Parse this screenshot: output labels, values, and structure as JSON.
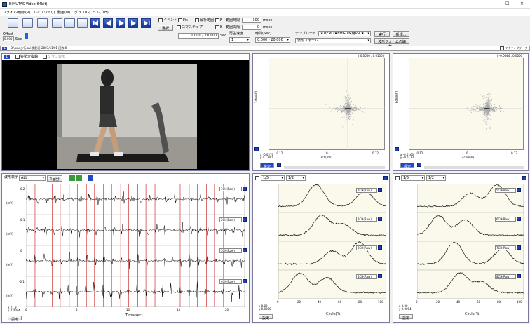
{
  "window": {
    "title": "BIMUTAS-Video(64bit)",
    "controls": [
      "–",
      "☐",
      "✕"
    ]
  },
  "menu": [
    "ファイル(F)",
    "表示(V)",
    "レイアウト(I)",
    "動画(M)",
    "グラフ(G)",
    "ヘルプ(H)"
  ],
  "toolbar": {
    "checks": [
      {
        "label": "イベント",
        "checked": true
      },
      {
        "label": "Fix",
        "checked": true
      },
      {
        "label": "解析範囲",
        "checked": true
      },
      {
        "label": "F",
        "checked": true
      },
      {
        "label": "B",
        "checked": false
      }
    ],
    "select_button": "選択",
    "frame_step_label": "コマステップ",
    "interval_label1": "範囲時間",
    "interval_value1": "300",
    "interval_unit1": "msec",
    "interval_label2": "範囲間隔",
    "interval_value2": "0",
    "interval_unit2": "msec",
    "offset_label": "Offset",
    "offset_value": "0.000",
    "offset_unit": "Sec",
    "time_value": "0.000 / 20.000",
    "time_unit": "Sec",
    "speed_label": "再生速度",
    "speed_value": "1",
    "interval_time_label": "時間(Sec)",
    "interval_time_value": "0.000 - 20.000",
    "template_label": "テンプレート",
    "template_value": "★DEMO★EMG TM用VR ★",
    "waveform_label": "波形フォーム",
    "run_button": "実行",
    "new_button": "新規...",
    "waveform_edit_button": "波形フォームの編集..."
  },
  "file_bar": {
    "index": "1",
    "text": "D:\\xxx\\歩行.avi  撮影日:2007/11/01  回数:0",
    "active_data": "アクティブデータ"
  },
  "video_panel": {
    "index": "1",
    "check1": "姿勢変換軸",
    "check2": "グラフ表示"
  },
  "scatter": [
    {
      "top_label": "( 0.0000 , 0.0100 )",
      "y_label": "2ch(mV)",
      "x_label": "3ch(mV)",
      "xticks": [
        "-0.12",
        "0",
        "0.12"
      ],
      "cursor": "x -0.0276\ny 0.1340",
      "button": "設定"
    },
    {
      "top_label": "( -0.0044 , 0.0000 )",
      "y_label": "6ch(mV)",
      "x_label": "4ch(mV)",
      "xticks": [
        "-0.12",
        "0",
        "0.12"
      ],
      "cursor": "x -0.0160\ny -0.0123",
      "button": "設定"
    }
  ],
  "emg": {
    "label": "波形表示",
    "combo": "ALL",
    "combo2": "1回分",
    "channels": [
      {
        "name": "1CH(Raw)",
        "ylabel": "(mV)",
        "tick": "0.2"
      },
      {
        "name": "2CH(Raw)",
        "ylabel": "(mV)",
        "tick": "0.1"
      },
      {
        "name": "3CH(Raw)",
        "ylabel": "(mV)",
        "tick": "0"
      },
      {
        "name": "4CH(Raw)",
        "ylabel": "(mV)",
        "tick": "-0.1"
      }
    ],
    "xticks": [
      "0",
      "5",
      "10",
      "15",
      "20"
    ],
    "x_axis_label": "Time(sec)",
    "cursor": "x 21.9\ny 0.0094",
    "button": "設定",
    "event_times": [
      0.9,
      1.7,
      2.6,
      3.4,
      4.3,
      5.1,
      6.0,
      6.8,
      7.7,
      8.5,
      9.4,
      10.2,
      11.1,
      11.9,
      12.8,
      13.6,
      14.5,
      15.3,
      16.2,
      17.0,
      17.9,
      18.7,
      19.6
    ]
  },
  "cycle_plots": [
    {
      "combo": "1/5",
      "combo2": "1/2",
      "channels": [
        "1CH(Raw)",
        "2CH(Raw)",
        "3CH(Raw)",
        "4CH(Raw)"
      ],
      "x_axis_label": "Cycle(%)",
      "xticks": [
        "0",
        "20",
        "40",
        "60",
        "80",
        "100"
      ],
      "cursor": "x 0.00\ny 0.0000",
      "button": "設定"
    },
    {
      "combo": "1/5",
      "combo2": "1/2",
      "channels": [
        "5CH(Raw)",
        "6CH(Raw)",
        "7CH(Raw)",
        "8CH(Raw)"
      ],
      "x_axis_label": "Cycle(%)",
      "xticks": [
        "0",
        "20",
        "40",
        "60",
        "80",
        "100"
      ],
      "cursor": "x 0.00\ny 0.0004",
      "button": "設定"
    }
  ],
  "colors": {
    "accent": "#2248c8",
    "event_line": "#d03030",
    "signal": "#000000",
    "scatter": "#aaaaaa",
    "plot_bg": "#fbf9ec"
  }
}
